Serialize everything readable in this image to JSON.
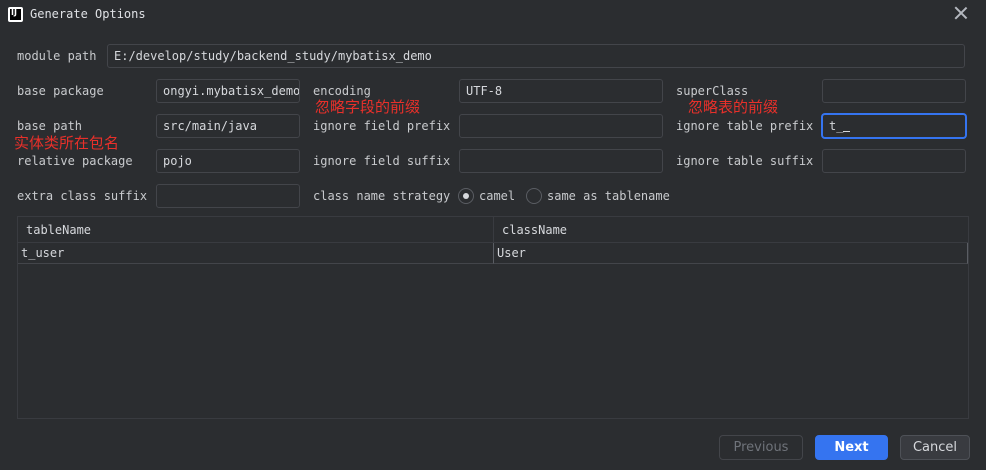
{
  "window": {
    "title": "Generate Options",
    "icon": "intellij-icon",
    "icon_text": "IJ"
  },
  "module_path": {
    "label": "module path",
    "value": "E:/develop/study/backend_study/mybatisx_demo"
  },
  "base_package": {
    "label": "base package",
    "value": "ongyi.mybatisx_demo"
  },
  "encoding": {
    "label": "encoding",
    "value": "UTF-8"
  },
  "super_class": {
    "label": "superClass",
    "value": ""
  },
  "base_path": {
    "label": "base path",
    "value": "src/main/java"
  },
  "ignore_field_prefix": {
    "label": "ignore field prefix",
    "value": ""
  },
  "ignore_table_prefix": {
    "label": "ignore table prefix",
    "value": "t_"
  },
  "relative_package": {
    "label": "relative package",
    "value": "pojo"
  },
  "ignore_field_suffix": {
    "label": "ignore field suffix",
    "value": ""
  },
  "ignore_table_suffix": {
    "label": "ignore table suffix",
    "value": ""
  },
  "extra_class_suffix": {
    "label": "extra class suffix",
    "value": ""
  },
  "class_name_strategy": {
    "label": "class name strategy",
    "options": [
      {
        "label": "camel",
        "checked": true
      },
      {
        "label": "same as tablename",
        "checked": false
      }
    ]
  },
  "annotations": {
    "ignore_field_prefix_note": "忽略字段的前缀",
    "ignore_table_prefix_note": "忽略表的前缀",
    "entity_package_note": "实体类所在包名"
  },
  "table": {
    "headers": [
      "tableName",
      "className"
    ],
    "rows": [
      {
        "tableName": "t_user",
        "className": "User"
      }
    ]
  },
  "buttons": {
    "previous": "Previous",
    "next": "Next",
    "cancel": "Cancel"
  },
  "colors": {
    "accent": "#3574f0",
    "annotation": "#e8302a",
    "background": "#2b2d30"
  }
}
